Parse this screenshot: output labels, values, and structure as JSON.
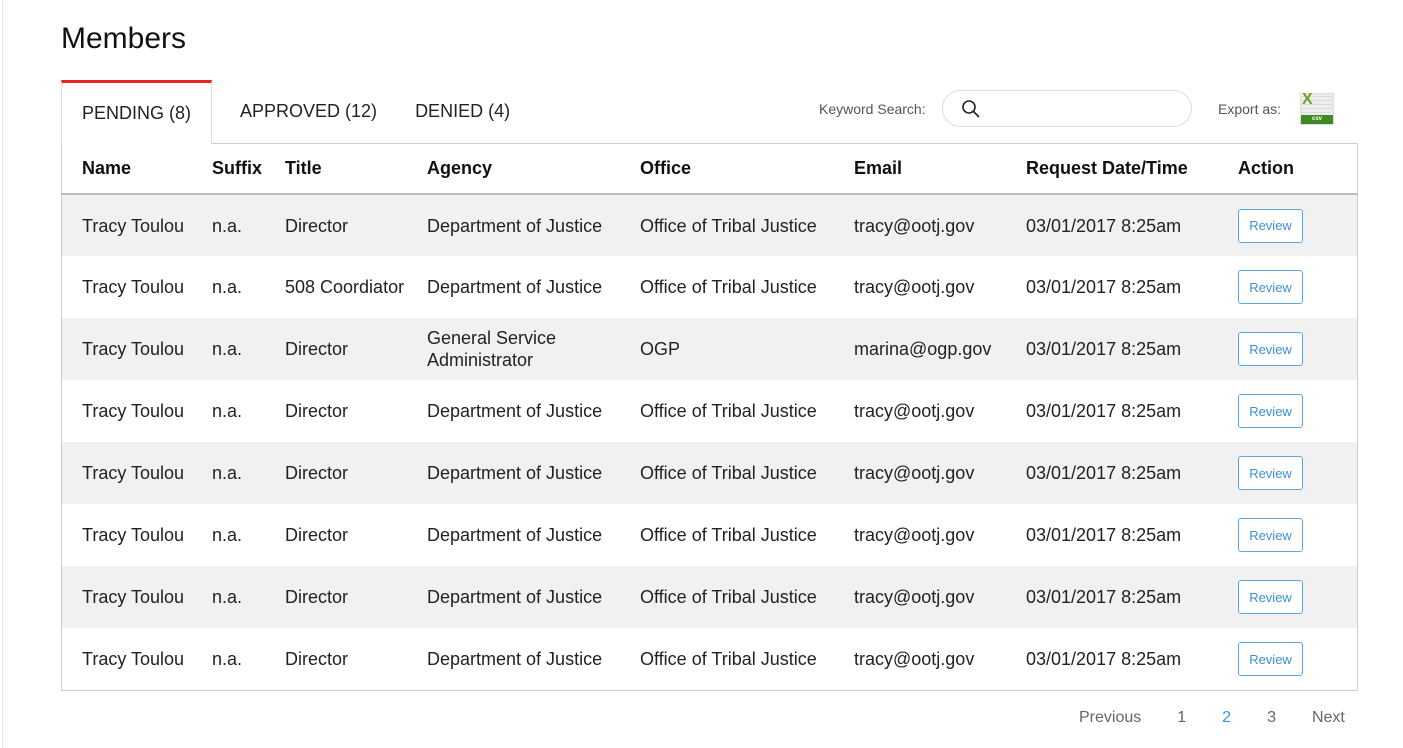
{
  "page_title": "Members",
  "tabs": [
    {
      "label": "PENDING (8)"
    },
    {
      "label": "APPROVED (12)"
    },
    {
      "label": "DENIED (4)"
    }
  ],
  "search": {
    "label": "Keyword Search:",
    "value": "",
    "placeholder": ""
  },
  "export": {
    "label": "Export as:",
    "icon": "excel-csv-icon",
    "icon_text": "csv"
  },
  "columns": [
    "Name",
    "Suffix",
    "Title",
    "Agency",
    "Office",
    "Email",
    "Request Date/Time",
    "Action"
  ],
  "rows": [
    {
      "name": "Tracy Toulou",
      "suffix": "n.a.",
      "title": "Director",
      "agency": "Department of Justice",
      "office": "Office of Tribal Justice",
      "email": "tracy@ootj.gov",
      "date": "03/01/2017 8:25am",
      "action": "Review"
    },
    {
      "name": "Tracy Toulou",
      "suffix": "n.a.",
      "title": "508 Coordiator",
      "agency": "Department of Justice",
      "office": "Office of Tribal Justice",
      "email": "tracy@ootj.gov",
      "date": "03/01/2017 8:25am",
      "action": "Review"
    },
    {
      "name": "Tracy Toulou",
      "suffix": "n.a.",
      "title": "Director",
      "agency": "General Service Administrator",
      "office": "OGP",
      "email": "marina@ogp.gov",
      "date": "03/01/2017 8:25am",
      "action": "Review"
    },
    {
      "name": "Tracy Toulou",
      "suffix": "n.a.",
      "title": "Director",
      "agency": "Department of Justice",
      "office": "Office of Tribal Justice",
      "email": "tracy@ootj.gov",
      "date": "03/01/2017 8:25am",
      "action": "Review"
    },
    {
      "name": "Tracy Toulou",
      "suffix": "n.a.",
      "title": "Director",
      "agency": "Department of Justice",
      "office": "Office of Tribal Justice",
      "email": "tracy@ootj.gov",
      "date": "03/01/2017 8:25am",
      "action": "Review"
    },
    {
      "name": "Tracy Toulou",
      "suffix": "n.a.",
      "title": "Director",
      "agency": "Department of Justice",
      "office": "Office of Tribal Justice",
      "email": "tracy@ootj.gov",
      "date": "03/01/2017 8:25am",
      "action": "Review"
    },
    {
      "name": "Tracy Toulou",
      "suffix": "n.a.",
      "title": "Director",
      "agency": "Department of Justice",
      "office": "Office of Tribal Justice",
      "email": "tracy@ootj.gov",
      "date": "03/01/2017 8:25am",
      "action": "Review"
    },
    {
      "name": "Tracy Toulou",
      "suffix": "n.a.",
      "title": "Director",
      "agency": "Department of Justice",
      "office": "Office of Tribal Justice",
      "email": "tracy@ootj.gov",
      "date": "03/01/2017 8:25am",
      "action": "Review"
    }
  ],
  "pagination": {
    "previous": "Previous",
    "pages": [
      "1",
      "2",
      "3"
    ],
    "current": "2",
    "next": "Next"
  },
  "colors": {
    "accent": "#e8221c",
    "link": "#2f9be6"
  }
}
